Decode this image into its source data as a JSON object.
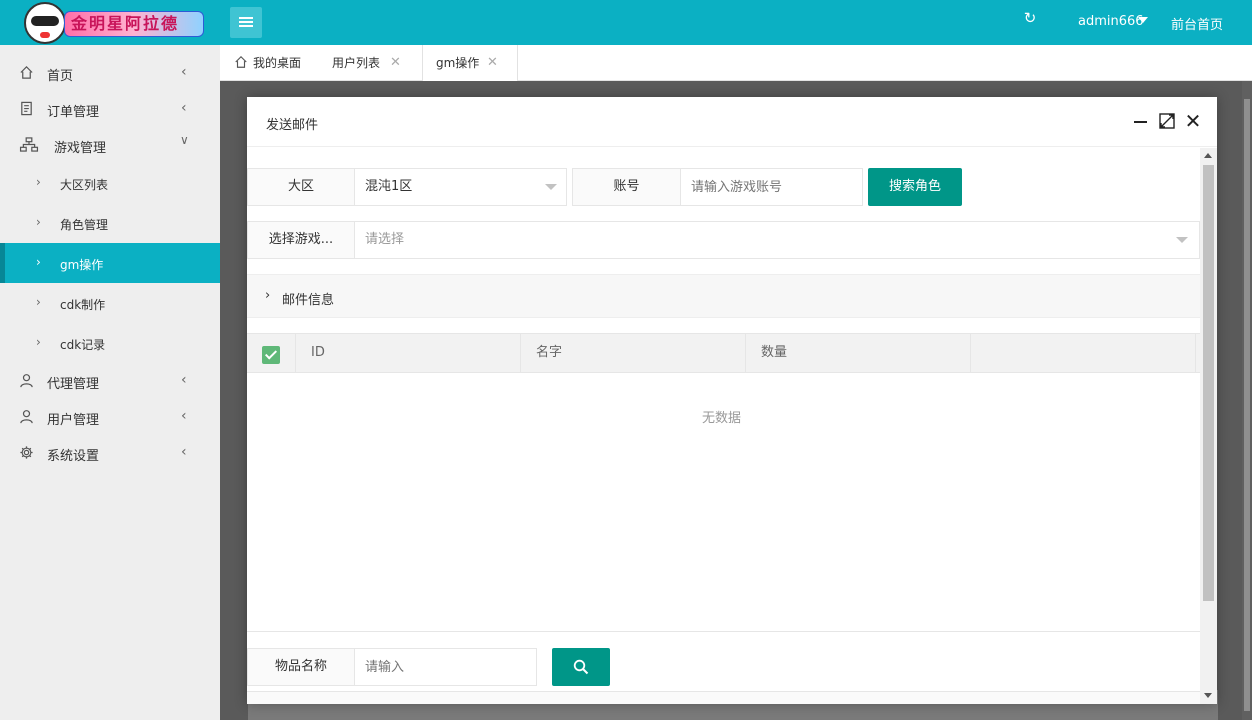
{
  "header": {
    "logo_text": "金明星阿拉德",
    "user_name": "admin666",
    "front_link": "前台首页"
  },
  "sidebar": {
    "items": [
      {
        "label": "首页",
        "icon": "home-icon"
      },
      {
        "label": "订单管理",
        "icon": "order-icon"
      },
      {
        "label": "游戏管理",
        "icon": "sitemap-icon"
      },
      {
        "label": "代理管理",
        "icon": "user-icon"
      },
      {
        "label": "用户管理",
        "icon": "user-icon"
      },
      {
        "label": "系统设置",
        "icon": "gear-icon"
      }
    ],
    "sub_items": [
      {
        "label": "大区列表"
      },
      {
        "label": "角色管理"
      },
      {
        "label": "gm操作",
        "active": true
      },
      {
        "label": "cdk制作"
      },
      {
        "label": "cdk记录"
      }
    ]
  },
  "tabs": [
    {
      "label": "我的桌面"
    },
    {
      "label": "用户列表"
    },
    {
      "label": "gm操作",
      "active": true
    }
  ],
  "modal": {
    "title": "发送邮件",
    "region_label": "大区",
    "region_value": "混沌1区",
    "account_label": "账号",
    "account_placeholder": "请输入游戏账号",
    "search_role_button": "搜索角色",
    "select_game_label": "选择游戏...",
    "select_placeholder": "请选择",
    "mail_info_label": "邮件信息",
    "table": {
      "columns": [
        "ID",
        "名字",
        "数量",
        ""
      ],
      "empty_text": "无数据"
    },
    "item_name_label": "物品名称",
    "item_name_placeholder": "请输入"
  },
  "colors": {
    "header_bg": "#0bb0c3",
    "active_nav": "#0bb0c3",
    "primary_button": "#009688",
    "checkbox": "#5fb878"
  }
}
